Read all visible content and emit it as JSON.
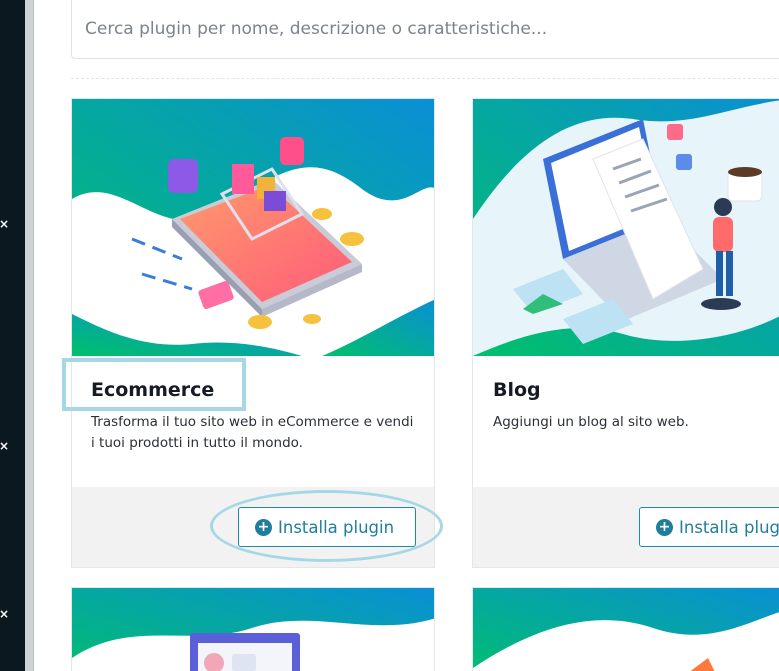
{
  "search": {
    "placeholder": "Cerca plugin per nome, descrizione o caratteristiche..."
  },
  "plugins": [
    {
      "title": "Ecommerce",
      "description": "Trasforma il tuo sito web in eCommerce e vendi i tuoi prodotti in tutto il mondo.",
      "button": "Installa plugin"
    },
    {
      "title": "Blog",
      "description": "Aggiungi un blog al sito web.",
      "button": "Installa plugin"
    }
  ],
  "colors": {
    "accent": "#1f7e9d",
    "gradient_start": "#00c06a",
    "gradient_end": "#0a8fd6",
    "highlight": "#a6d7e4"
  },
  "icons": {
    "button_icon": "plus-circle-icon"
  }
}
